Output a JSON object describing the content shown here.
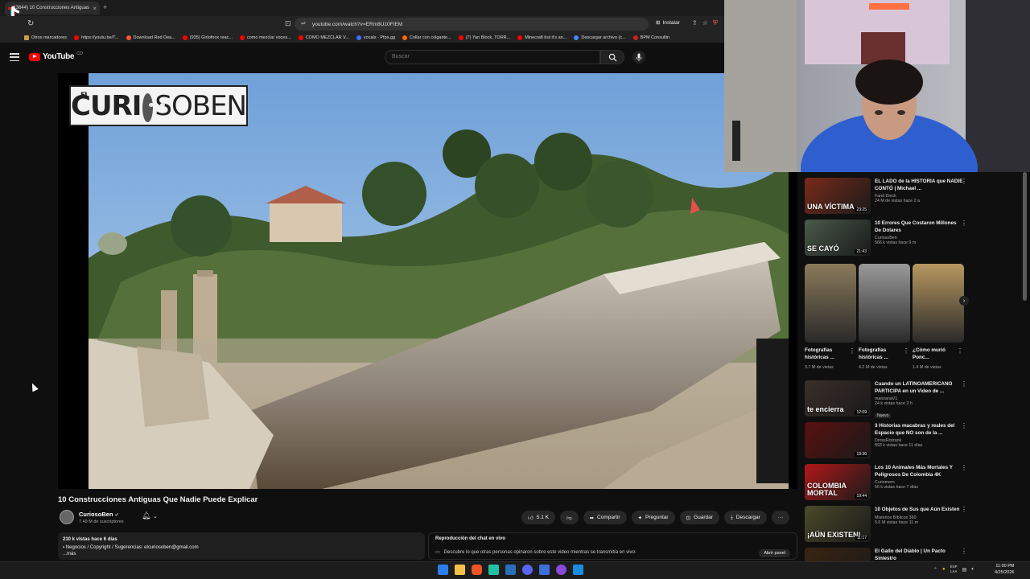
{
  "browser": {
    "tab_title": "(3644) 10 Construcciones Antiguas",
    "tab_close": "×",
    "new_tab": "+",
    "url": "youtube.com/watch?v=ERm8U10FIEM",
    "install_label": "Instalar",
    "bookmarks": [
      {
        "label": "Otros marcadores",
        "color": "#c8a040"
      },
      {
        "label": "https://youtu.be/T...",
        "color": "#ff0000"
      },
      {
        "label": "Download Red Dea...",
        "color": "#ff5533"
      },
      {
        "label": "(935) Girlofnox reac...",
        "color": "#ff0000"
      },
      {
        "label": "como mezclar voces...",
        "color": "#ff0000"
      },
      {
        "label": "COMO MEZCLAR V...",
        "color": "#ff0000"
      },
      {
        "label": "vocals - Pfps.gg",
        "color": "#3f6fff"
      },
      {
        "label": "Collar con colgante...",
        "color": "#ff6600"
      },
      {
        "label": "(7) Yan Block, TORR...",
        "color": "#ff0000"
      },
      {
        "label": "Minecraft but it's an...",
        "color": "#ff0000"
      },
      {
        "label": "Descargar archivo (c...",
        "color": "#4488ff"
      },
      {
        "label": "BPM Consultin",
        "color": "#cc2222"
      }
    ]
  },
  "youtube": {
    "logo_text": "YouTube",
    "logo_region": "CO",
    "search_placeholder": "Buscar"
  },
  "video": {
    "brand_el": "EL",
    "brand_left": "CURI",
    "brand_right": "SOBEN",
    "title": "10 Construcciones Antiguas Que Nadie Puede Explicar",
    "channel": "CuriosoBen",
    "subscribers": "7.49 M de suscriptores",
    "likes": "5.1 K",
    "share": "Compartir",
    "ask": "Preguntar",
    "save": "Guardar",
    "download": "Descargar",
    "more": "···",
    "views_line": "210 k vistas  hace 6 días",
    "desc_line": "Negocios / Copyright / Sugerencias: elcuriosoben@gmail.com",
    "desc_more": "...más"
  },
  "chat": {
    "header": "Reproducción del chat en vivo",
    "text": "Descubre lo que otras personas opinaron sobre este video mientras se transmitía en vivo.",
    "open": "Abrir panel"
  },
  "sidebar": {
    "items": [
      {
        "title": "EL LADO de la HISTORIA que NADIE CONTÓ | Michael ...",
        "channel": "Farid Dieck",
        "meta": "24 M de vistas  hace 2 a",
        "duration": "23:25",
        "thumb_text": "UNA VÍCTIMA",
        "thumb_color": "#7a2a1a"
      },
      {
        "title": "10 Errores Que Costaron Millones De Dólares",
        "channel": "CuriosoBen",
        "meta": "566 k vistas  hace 9 m",
        "duration": "21:43",
        "thumb_text": "SE CAYÓ",
        "thumb_color": "#4a5a4a"
      },
      {
        "title": "Cuando un LATINOAMERICANO PARTICIPA en un Video de ...",
        "channel": "manzanaV1",
        "meta": "24 k vistas  hace 2 h",
        "duration": "12:09",
        "thumb_text": "te encierra",
        "thumb_color": "#3a2e2a",
        "badge": "Nuevo"
      },
      {
        "title": "3 Historias macabras y reales del Espacio que NO son de la ...",
        "channel": "DrossRotzank",
        "meta": "893 k vistas  hace 11 días",
        "duration": "19:30",
        "thumb_text": "",
        "thumb_color": "#5a1010"
      },
      {
        "title": "Los 10 Animales Más Mortales Y Peligrosos De Colombia 4K",
        "channel": "Curiomero",
        "meta": "56 k vistas  hace 7 días",
        "duration": "19:44",
        "thumb_text": "COLOMBIA MORTAL",
        "thumb_color": "#b01818"
      },
      {
        "title": "10 Objetos de Sus que Aún Existen",
        "channel": "Misterios Bíblicos 360",
        "meta": "5.6 M vistas  hace 11 m",
        "duration": "11:17",
        "thumb_text": "¡AÚN EXISTEN!",
        "thumb_color": "#4a4a2a"
      },
      {
        "title": "El Gallo del Diablo | Un Pacto Siniestro",
        "channel": "",
        "meta": "",
        "duration": "",
        "thumb_text": "",
        "thumb_color": "#3a2410"
      }
    ],
    "shorts": [
      {
        "title": "Fotografías históricas ...",
        "views": "3.7 M de vistas",
        "color": "#8a7a5a"
      },
      {
        "title": "Fotografías históricas ...",
        "views": "4.2 M de vistas",
        "color": "#9a9a9a"
      },
      {
        "title": "¿Cómo murió Ponc...",
        "views": "1.4 M de vistas",
        "color": "#b89860"
      }
    ]
  },
  "taskbar": {
    "lang": "ESP",
    "lang2": "LAA",
    "time": "11:00 PM",
    "date": "4/25/2026"
  }
}
